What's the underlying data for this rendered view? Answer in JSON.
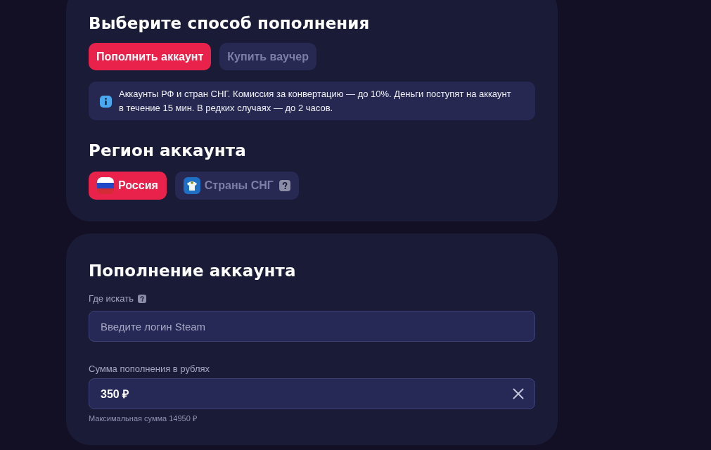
{
  "method_card": {
    "title": "Выберите способ пополнения",
    "methods": [
      {
        "label": "Пополнить аккаунт",
        "selected": true
      },
      {
        "label": "Купить ваучер",
        "selected": false
      }
    ],
    "info": {
      "text": "Аккаунты РФ и стран СНГ. Комиссия за конвертацию — до 10%. Деньги поступят на аккаунт в течение 15 мин. В редких случаях — до 2 часов."
    },
    "region_title": "Регион аккаунта",
    "regions": [
      {
        "label": "Россия",
        "kind": "flag",
        "selected": true,
        "help": false
      },
      {
        "label": "Страны СНГ",
        "kind": "emblem",
        "selected": false,
        "help": true
      }
    ]
  },
  "topup_card": {
    "title": "Пополнение аккаунта",
    "login_field": {
      "label": "Где искать",
      "help": true,
      "placeholder": "Введите логин Steam"
    },
    "amount_field": {
      "label": "Сумма пополнения в рублях",
      "value": "350 ₽",
      "clearable": true,
      "hint": "Максимальная сумма 14950 ₽"
    }
  }
}
